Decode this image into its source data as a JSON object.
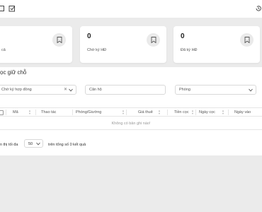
{
  "summary_cards": [
    {
      "value": "",
      "label": "cả"
    },
    {
      "value": "0",
      "label": "Chờ ký HĐ"
    },
    {
      "value": "0",
      "label": "Đã ký HĐ"
    }
  ],
  "section": {
    "title": "ọc giữ chỗ"
  },
  "filters": {
    "status_select": "Chờ ký hợp đồng",
    "apartment_select": "Căn hộ",
    "room_select": "Phòng"
  },
  "table": {
    "columns": [
      "Mã",
      "Thao tác",
      "Phòng/Giường",
      "Giá thuê",
      "Tiền cọc",
      "Ngày cọc",
      "Ngày vào"
    ],
    "empty_message": "Không có bản ghi nào!"
  },
  "pagination": {
    "prefix": "n thị tối đa",
    "page_size": "50",
    "suffix": "trên tổng số 0 kết quả"
  },
  "colors": {
    "background": "#ebebeb",
    "panel": "#ffffff",
    "border": "#d9d9d9"
  }
}
